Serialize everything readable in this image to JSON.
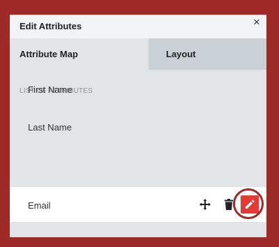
{
  "dialog": {
    "title": "Edit Attributes",
    "close_label": "×"
  },
  "tabs": [
    {
      "label": "Attribute Map",
      "active": true
    },
    {
      "label": "Layout",
      "active": false
    }
  ],
  "section": {
    "label": "LIST OF ATTRIBUTES"
  },
  "attributes": [
    {
      "label": "First Name"
    },
    {
      "label": "Last Name"
    },
    {
      "label": "Email",
      "selected": true
    }
  ],
  "row_actions": {
    "icons": [
      "move-icon",
      "trash-icon",
      "edit-icon"
    ]
  },
  "colors": {
    "background": "#9e2a27",
    "panel": "#e1e5e8",
    "active_tab_inverse": "#c9d1d6",
    "edit_button": "#e53935",
    "highlight_ring": "#9e2a27"
  }
}
